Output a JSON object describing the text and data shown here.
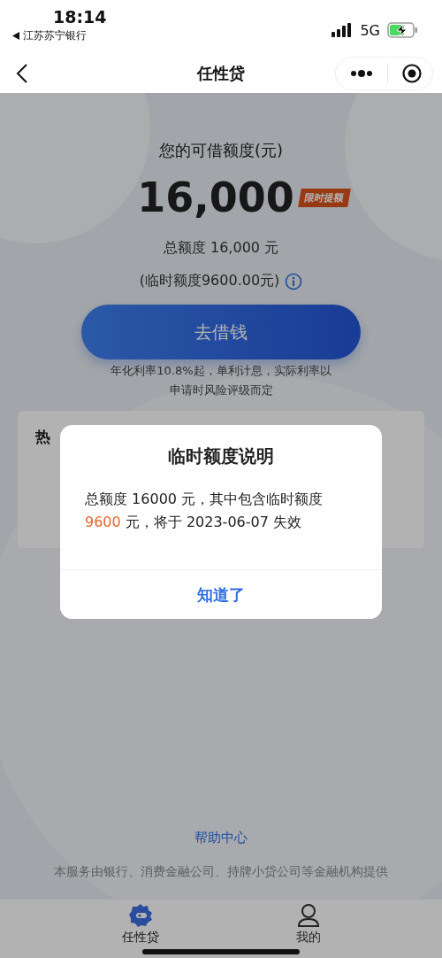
{
  "status_bar": {
    "time": "18:14",
    "back_app": "江苏苏宁银行",
    "network": "5G",
    "charging": true
  },
  "nav": {
    "title": "任性贷"
  },
  "credit": {
    "label": "您的可借额度(元)",
    "amount": "16,000",
    "badge": "限时提额",
    "total": "总额度 16,000 元",
    "temporary": "(临时额度9600.00元)",
    "borrow_button": "去借钱",
    "note_lines": [
      "年化利率10.8%起，单利计息，实际利率以",
      "申请时风险评级而定"
    ]
  },
  "hot_card": {
    "title": "热"
  },
  "help_link": "帮助中心",
  "disclaimer": "本服务由银行、消费金融公司、持牌小贷公司等金融机构提供",
  "tabs": [
    {
      "label": "任性贷",
      "selected": true,
      "kind": "wallet"
    },
    {
      "label": "我的",
      "selected": false,
      "kind": "person"
    }
  ],
  "dialog": {
    "title": "临时额度说明",
    "message_before": "总额度 16000 元，其中包含临时额度",
    "highlight": "9600",
    "message_after": " 元，将于 2023-06-07 失效",
    "button": "知道了"
  }
}
